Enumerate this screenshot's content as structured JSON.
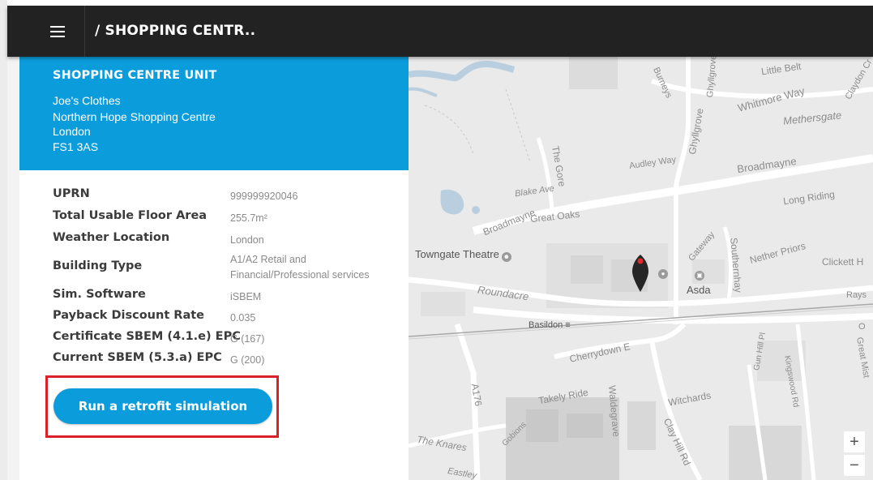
{
  "header": {
    "title": "/ SHOPPING CENTR..",
    "menu_icon": "hamburger-menu-icon"
  },
  "property": {
    "type_heading": "SHOPPING CENTRE UNIT",
    "address": [
      "Joe's Clothes",
      "Northern Hope Shopping Centre",
      "London",
      "FS1 3AS"
    ]
  },
  "details": [
    {
      "label": "UPRN",
      "value": "999999920046"
    },
    {
      "label": "Total Usable Floor Area",
      "value": "255.7m²"
    },
    {
      "label": "Weather Location",
      "value": "London"
    },
    {
      "label": "Building Type",
      "value_lines": [
        "A1/A2 Retail and",
        "Financial/Professional services"
      ]
    },
    {
      "label": "Sim. Software",
      "value": "iSBEM"
    },
    {
      "label": "Payback Discount Rate",
      "value": "0.035"
    },
    {
      "label": "Certificate SBEM (4.1.e) EPC",
      "value": "G (167)"
    },
    {
      "label": "Current SBEM (5.3.a) EPC",
      "value": "G (200)"
    }
  ],
  "cta": {
    "label": "Run a retrofit simulation"
  },
  "map": {
    "labels": {
      "little_belt": "Little Belt",
      "burneys": "Burneys",
      "ghyllgrove_top": "Ghyllgrove",
      "whitmore_way": "Whitmore Way",
      "claydon": "Claydon Cr",
      "methersgate": "Methersgate",
      "ghyllgrove": "Ghyllgrove",
      "audley_way": "Audley Way",
      "broadmayne_east": "Broadmayne",
      "the_gore": "The Gore",
      "blake_ave": "Blake Ave",
      "long_riding": "Long Riding",
      "broadmayne_west": "Broadmayne",
      "great_oaks": "Great Oaks",
      "towngate_theatre": "Towngate Theatre",
      "gateway": "Gateway",
      "southernhay": "Southernhay",
      "nether_priors": "Nether Priors",
      "clickett": "Clickett H",
      "asda": "Asda",
      "roundacre": "Roundacre",
      "rays": "Rays",
      "basildon": "Basildon",
      "o_label": "O",
      "cherrydown": "Cherrydown E",
      "gun_hill": "Gun Hill Pl",
      "great_mist": "Great Mist",
      "kingswood": "Kingswood Rd",
      "a176": "A176",
      "takely_ride": "Takely Ride",
      "waldegrave": "Waldegrave",
      "witchards": "Witchards",
      "clay_hill": "Clay Hill Rd",
      "gobions": "Gobions",
      "the_knares": "The Knares",
      "eastley": "Eastley"
    },
    "zoom_in": "+",
    "zoom_out": "−",
    "pin_icon": "location-pin-icon"
  }
}
